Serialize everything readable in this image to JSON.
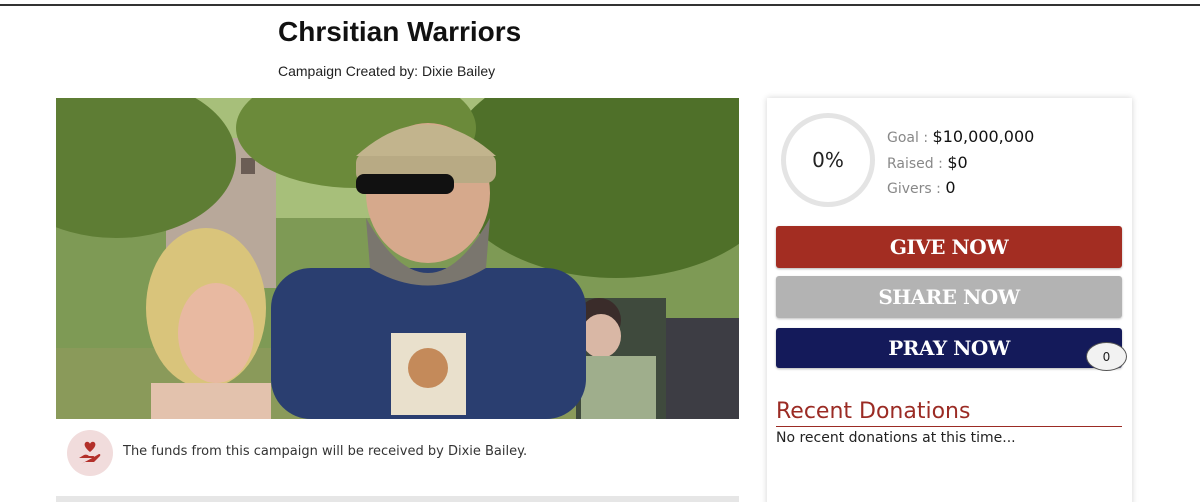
{
  "campaign": {
    "title": "Chrsitian Warriors",
    "creator_line": "Campaign Created by: Dixie Bailey",
    "funds_notice": "The funds from this campaign will be received by Dixie Bailey."
  },
  "stats": {
    "percent_label": "0%",
    "percent_value": 0,
    "goal_label": "Goal :",
    "goal_value": "$10,000,000",
    "raised_label": "Raised :",
    "raised_value": "$0",
    "givers_label": "Givers :",
    "givers_value": "0"
  },
  "actions": {
    "give_label": "GIVE NOW",
    "share_label": "SHARE NOW",
    "pray_label": "PRAY NOW",
    "pray_count": "0"
  },
  "donations": {
    "heading": "Recent Donations",
    "empty_text": "No recent donations at this time..."
  },
  "colors": {
    "give": "#a32d22",
    "share": "#b3b3b3",
    "pray": "#141a5a",
    "accent": "#9b2b24"
  },
  "icons": {
    "funds": "hand-heart-icon"
  }
}
